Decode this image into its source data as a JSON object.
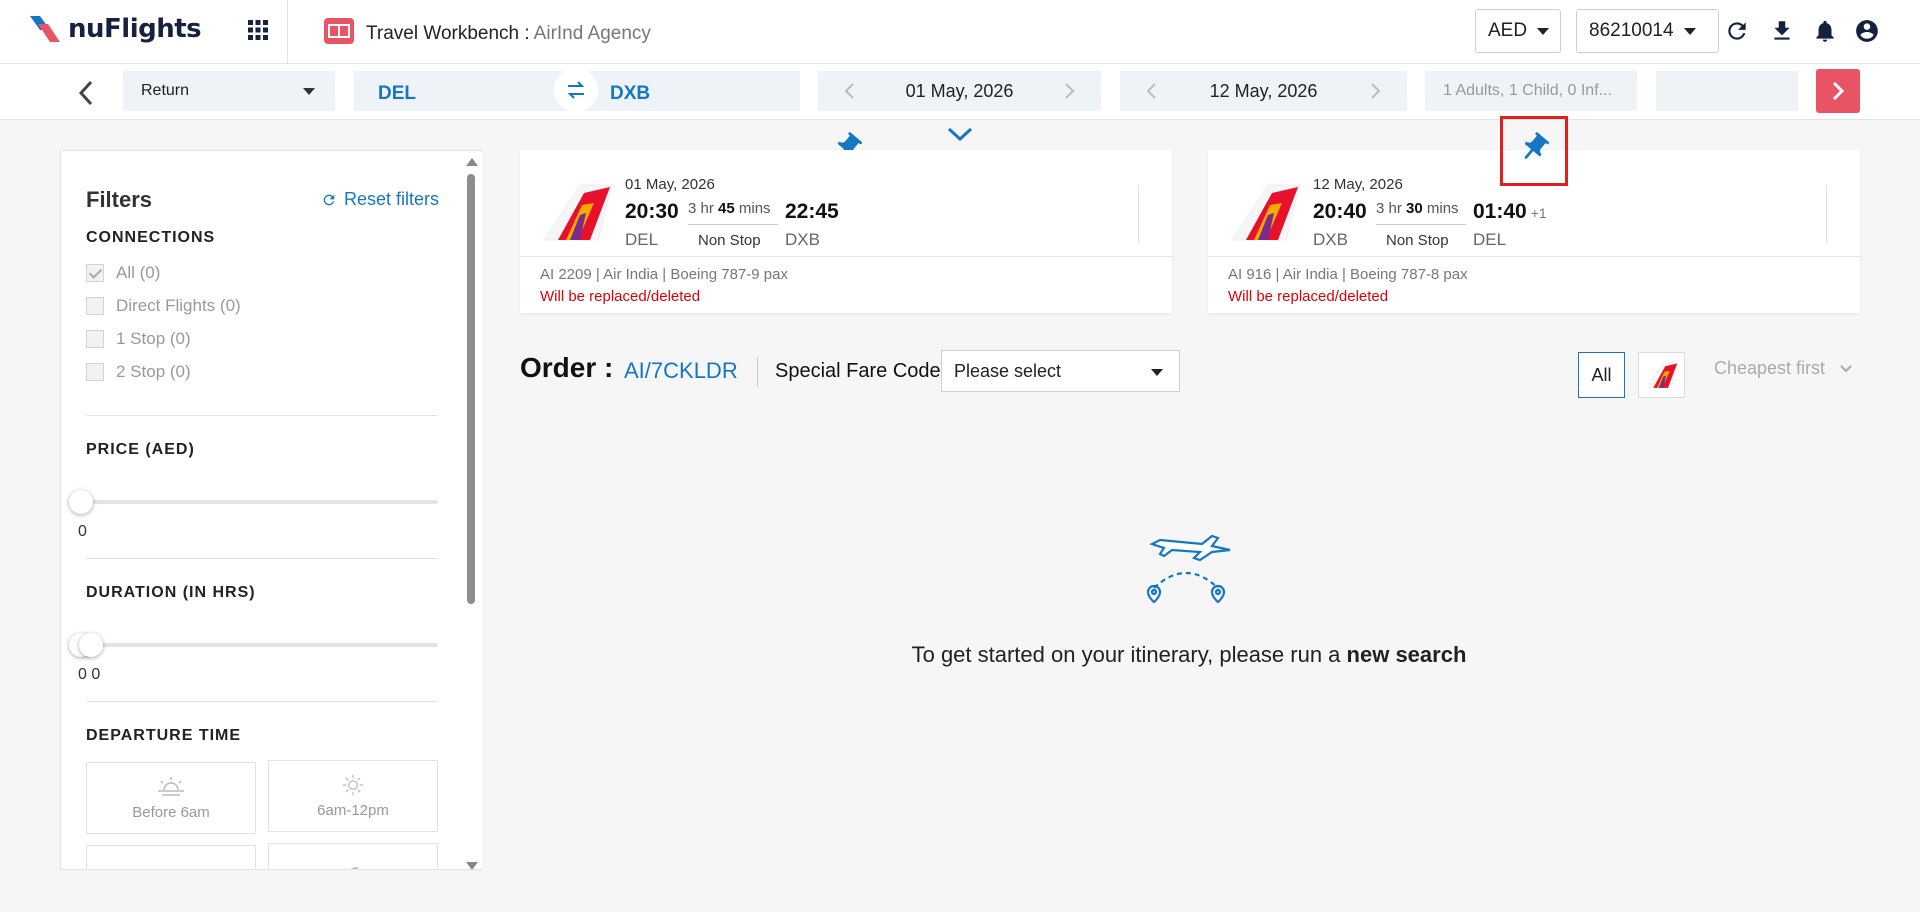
{
  "header": {
    "logo_text": "nuFlights",
    "app_title": "Travel Workbench :",
    "agency": "AirInd Agency",
    "currency": "AED",
    "account": "86210014",
    "colors": {
      "brand_red": "#e85463",
      "accent_blue": "#1577c4",
      "navy": "#15213f"
    }
  },
  "search": {
    "trip_type": "Return",
    "origin": "DEL",
    "destination": "DXB",
    "depart_date": "01 May, 2026",
    "return_date": "12 May, 2026",
    "passengers": "1 Adults, 1 Child, 0 Inf..."
  },
  "filters": {
    "title": "Filters",
    "reset_label": "Reset filters",
    "connections": {
      "title": "CONNECTIONS",
      "options": [
        {
          "label": "All (0)",
          "checked": true
        },
        {
          "label": "Direct Flights (0)",
          "checked": false
        },
        {
          "label": "1 Stop (0)",
          "checked": false
        },
        {
          "label": "2 Stop (0)",
          "checked": false
        }
      ]
    },
    "price": {
      "title": "PRICE (AED)",
      "value": "0"
    },
    "duration": {
      "title": "DURATION (IN HRS)",
      "value": "0 0"
    },
    "departure_time": {
      "title": "DEPARTURE TIME",
      "options": [
        {
          "label": "Before 6am",
          "icon": "sunrise-icon"
        },
        {
          "label": "6am-12pm",
          "icon": "sun-icon"
        }
      ]
    }
  },
  "flights": [
    {
      "date": "01 May, 2026",
      "dep_time": "20:30",
      "dep_code": "DEL",
      "duration_hr": "3",
      "duration_min": "45",
      "stops": "Non Stop",
      "arr_time": "22:45",
      "arr_plus": "",
      "arr_code": "DXB",
      "flight_info": "AI 2209 | Air India | Boeing 787-9 pax",
      "warning": "Will be replaced/deleted"
    },
    {
      "date": "12 May, 2026",
      "dep_time": "20:40",
      "dep_code": "DXB",
      "duration_hr": "3",
      "duration_min": "30",
      "stops": "Non Stop",
      "arr_time": "01:40",
      "arr_plus": "+1",
      "arr_code": "DEL",
      "flight_info": "AI 916 | Air India | Boeing 787-8 pax",
      "warning": "Will be replaced/deleted"
    }
  ],
  "duration_units": {
    "hr": "hr",
    "min": "mins"
  },
  "order": {
    "label": "Order :",
    "id": "AI/7CKLDR",
    "special_fare_label": "Special Fare Code",
    "special_fare_value": "Please select"
  },
  "results_toolbar": {
    "all_label": "All",
    "sort_label": "Cheapest first"
  },
  "empty_state": {
    "message": "To get started on your itinerary, please run a",
    "action": "new search"
  }
}
